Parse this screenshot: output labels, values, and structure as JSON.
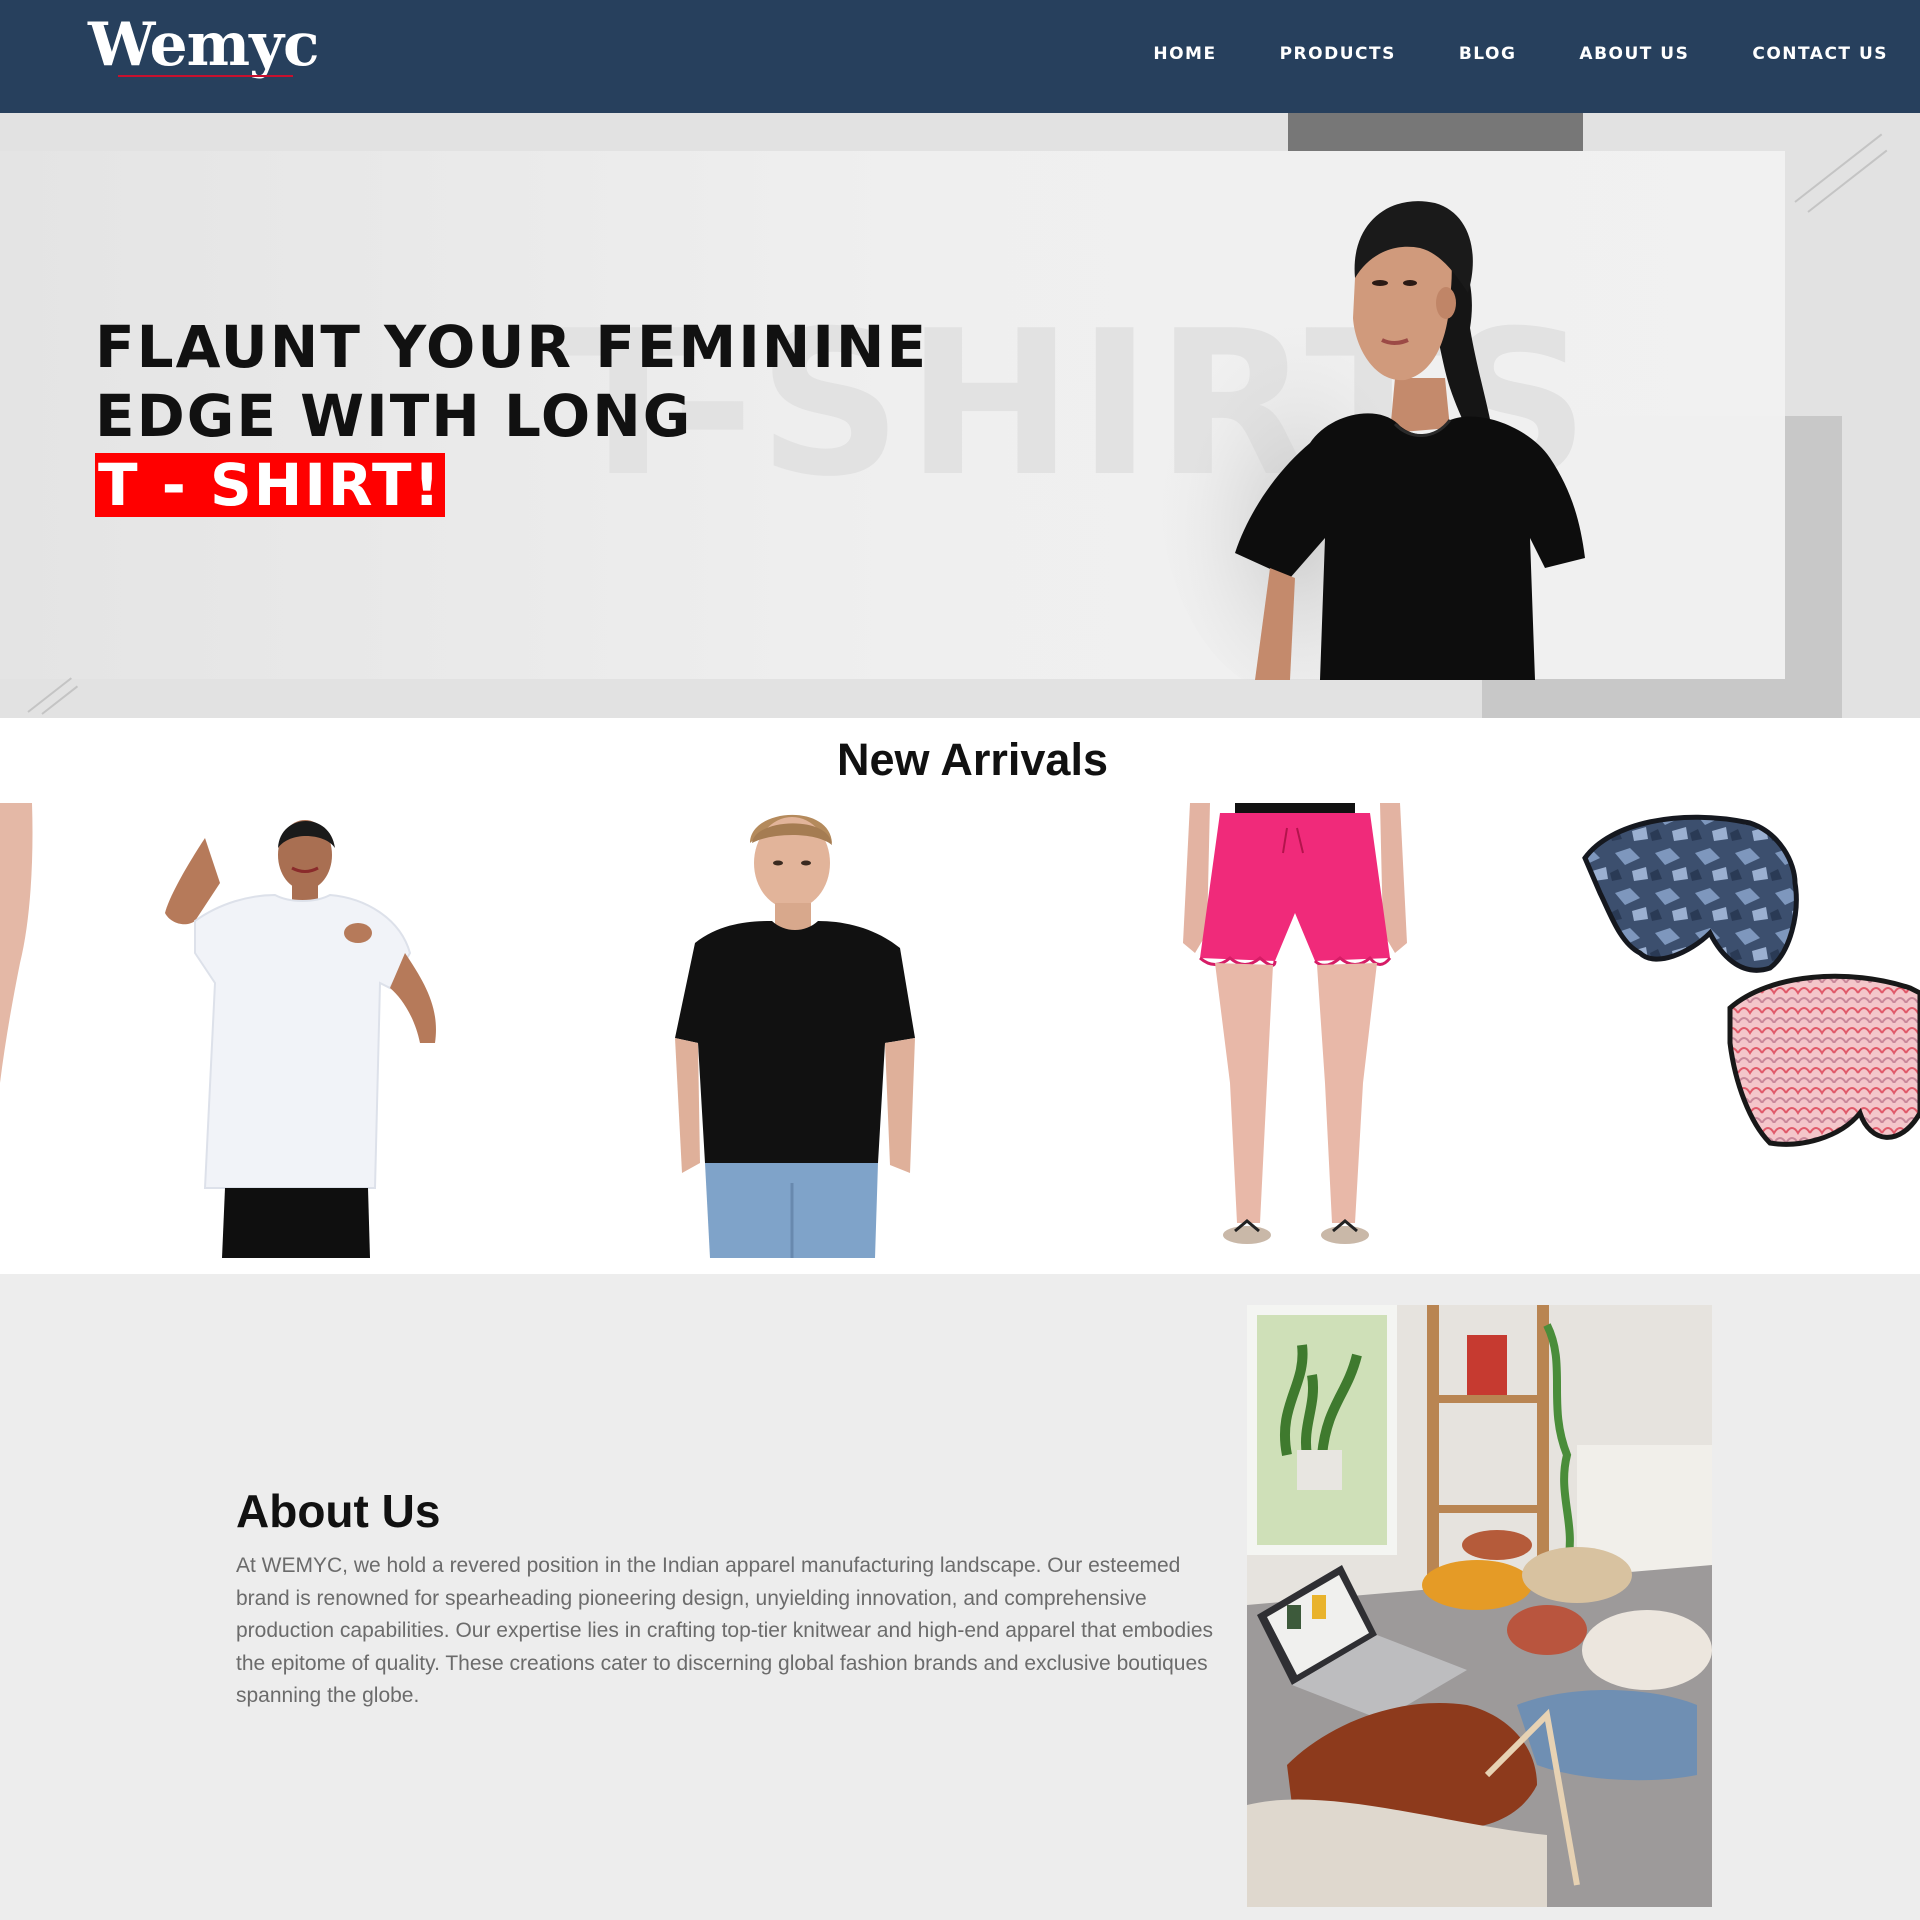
{
  "header": {
    "logo": "Wemyc",
    "nav": [
      "HOME",
      "PRODUCTS",
      "BLOG",
      "ABOUT US",
      "CONTACT US"
    ]
  },
  "hero": {
    "title_line1": "FLAUNT YOUR FEMININE",
    "title_line2": "EDGE WITH LONG",
    "title_highlight": "T - SHIRT!",
    "background_word": "T-SHIRTS"
  },
  "arrivals": {
    "title": "New Arrivals"
  },
  "about": {
    "title": "About Us",
    "text": "At WEMYC, we hold a revered position in the Indian apparel manufacturing landscape. Our esteemed brand is renowned for spearheading pioneering design, unyielding innovation, and comprehensive production capabilities. Our expertise lies in crafting top-tier knitwear and high-end apparel that embodies the epitome of quality. These creations cater to discerning global fashion brands and exclusive boutiques spanning the globe."
  },
  "colors": {
    "header_bg": "#27405d",
    "accent_red": "#ff0000",
    "about_bg": "#ededed"
  }
}
